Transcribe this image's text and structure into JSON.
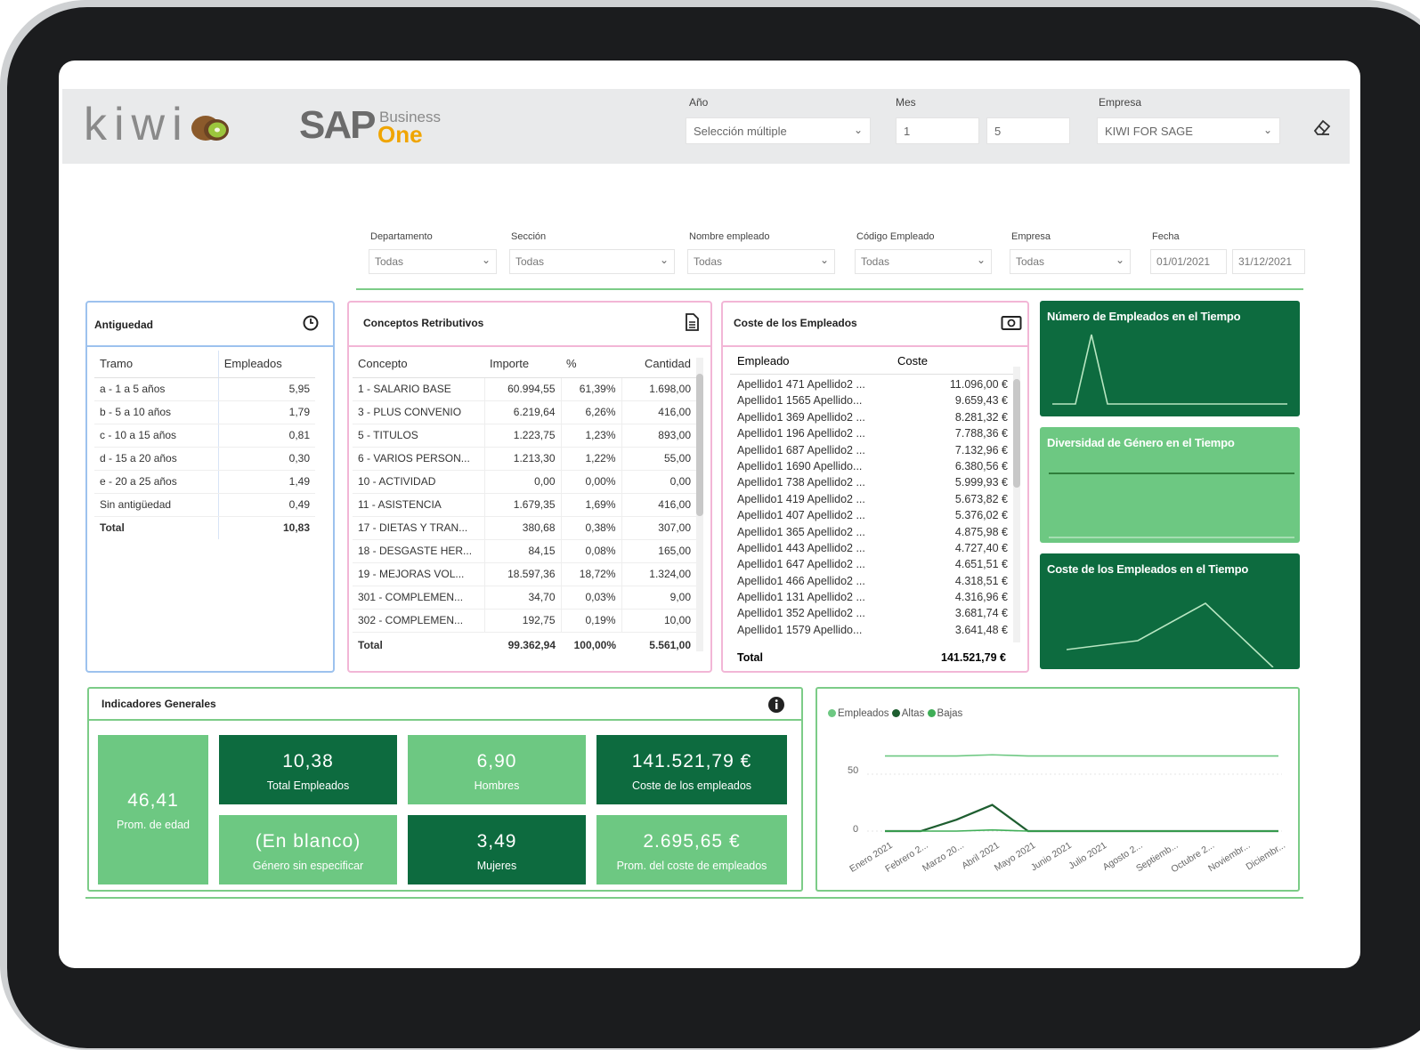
{
  "header": {
    "logo_kiwi": "kiwi",
    "logo_sap": "SAP",
    "logo_business": "Business",
    "logo_one": "One",
    "filters": {
      "anio_label": "Año",
      "anio_value": "Selección múltiple",
      "mes_label": "Mes",
      "mes_from": "1",
      "mes_to": "5",
      "empresa_label": "Empresa",
      "empresa_value": "KIWI FOR SAGE"
    }
  },
  "slicers": {
    "departamento": {
      "label": "Departamento",
      "value": "Todas"
    },
    "seccion": {
      "label": "Sección",
      "value": "Todas"
    },
    "nombre": {
      "label": "Nombre empleado",
      "value": "Todas"
    },
    "codigo": {
      "label": "Código Empleado",
      "value": "Todas"
    },
    "empresa": {
      "label": "Empresa",
      "value": "Todas"
    },
    "fecha": {
      "label": "Fecha",
      "from": "01/01/2021",
      "to": "31/12/2021"
    }
  },
  "antiguedad": {
    "title": "Antiguedad",
    "headers": [
      "Tramo",
      "Empleados"
    ],
    "rows": [
      [
        "a - 1 a 5 años",
        "5,95"
      ],
      [
        "b - 5 a 10 años",
        "1,79"
      ],
      [
        "c - 10 a 15 años",
        "0,81"
      ],
      [
        "d - 15 a 20 años",
        "0,30"
      ],
      [
        "e - 20 a 25 años",
        "1,49"
      ],
      [
        "Sin antigüedad",
        "0,49"
      ]
    ],
    "total": [
      "Total",
      "10,83"
    ]
  },
  "conceptos": {
    "title": "Conceptos Retributivos",
    "headers": [
      "Concepto",
      "Importe",
      "%",
      "Cantidad"
    ],
    "rows": [
      [
        "1 - SALARIO BASE",
        "60.994,55",
        "61,39%",
        "1.698,00"
      ],
      [
        "3 - PLUS CONVENIO",
        "6.219,64",
        "6,26%",
        "416,00"
      ],
      [
        "5 - TITULOS",
        "1.223,75",
        "1,23%",
        "893,00"
      ],
      [
        "6 - VARIOS PERSON...",
        "1.213,30",
        "1,22%",
        "55,00"
      ],
      [
        "10 - ACTIVIDAD",
        "0,00",
        "0,00%",
        "0,00"
      ],
      [
        "11 - ASISTENCIA",
        "1.679,35",
        "1,69%",
        "416,00"
      ],
      [
        "17 - DIETAS Y TRAN...",
        "380,68",
        "0,38%",
        "307,00"
      ],
      [
        "18 - DESGASTE HER...",
        "84,15",
        "0,08%",
        "165,00"
      ],
      [
        "19 - MEJORAS VOL...",
        "18.597,36",
        "18,72%",
        "1.324,00"
      ],
      [
        "301 - COMPLEMEN...",
        "34,70",
        "0,03%",
        "9,00"
      ],
      [
        "302 - COMPLEMEN...",
        "192,75",
        "0,19%",
        "10,00"
      ]
    ],
    "total": [
      "Total",
      "99.362,94",
      "100,00%",
      "5.561,00"
    ]
  },
  "coste": {
    "title": "Coste de los Empleados",
    "headers": [
      "Empleado",
      "Coste"
    ],
    "rows": [
      [
        "Apellido1 471 Apellido2 ...",
        "11.096,00 €"
      ],
      [
        "Apellido1 1565 Apellido...",
        "9.659,43 €"
      ],
      [
        "Apellido1 369 Apellido2 ...",
        "8.281,32 €"
      ],
      [
        "Apellido1 196 Apellido2 ...",
        "7.788,36 €"
      ],
      [
        "Apellido1 687 Apellido2 ...",
        "7.132,96 €"
      ],
      [
        "Apellido1 1690 Apellido...",
        "6.380,56 €"
      ],
      [
        "Apellido1 738 Apellido2 ...",
        "5.999,93 €"
      ],
      [
        "Apellido1 419 Apellido2 ...",
        "5.673,82 €"
      ],
      [
        "Apellido1 407 Apellido2 ...",
        "5.376,02 €"
      ],
      [
        "Apellido1 365 Apellido2 ...",
        "4.875,98 €"
      ],
      [
        "Apellido1 443 Apellido2 ...",
        "4.727,40 €"
      ],
      [
        "Apellido1 647 Apellido2 ...",
        "4.651,51 €"
      ],
      [
        "Apellido1 466 Apellido2 ...",
        "4.318,51 €"
      ],
      [
        "Apellido1 131 Apellido2 ...",
        "4.316,96 €"
      ],
      [
        "Apellido1 352 Apellido2 ...",
        "3.681,74 €"
      ],
      [
        "Apellido1 1579 Apellido...",
        "3.641,48 €"
      ]
    ],
    "total": [
      "Total",
      "141.521,79 €"
    ]
  },
  "tiles": {
    "numero": "Número de Empleados en el Tiempo",
    "diversidad": "Diversidad de Género en el Tiempo",
    "coste": "Coste de los Empleados en el Tiempo"
  },
  "indicadores": {
    "title": "Indicadores Generales",
    "cards": [
      {
        "value": "46,41",
        "label": "Prom. de edad"
      },
      {
        "value": "10,38",
        "label": "Total Empleados"
      },
      {
        "value": "6,90",
        "label": "Hombres"
      },
      {
        "value": "141.521,79 €",
        "label": "Coste de los empleados"
      },
      {
        "value": "(En blanco)",
        "label": "Género sin especificar"
      },
      {
        "value": "3,49",
        "label": "Mujeres"
      },
      {
        "value": "2.695,65 €",
        "label": "Prom. del coste de empleados"
      }
    ]
  },
  "colors": {
    "dark_green": "#0d6b3f",
    "light_green": "#6dc882",
    "accent_line": "#7ccc87"
  },
  "chart_data": {
    "type": "line",
    "legend": [
      "Empleados",
      "Altas",
      "Bajas"
    ],
    "legend_position": "top-left",
    "categories": [
      "Enero 2021",
      "Febrero 2...",
      "Marzo 20...",
      "Abril 2021",
      "Mayo 2021",
      "Junio 2021",
      "Julio 2021",
      "Agosto 2...",
      "Septiemb...",
      "Octubre 2...",
      "Noviembr...",
      "Diciembr..."
    ],
    "y_ticks": [
      "0",
      "50"
    ],
    "ylim": [
      0,
      50
    ],
    "series": [
      {
        "name": "Empleados",
        "color": "#6dc882",
        "values": [
          66,
          66,
          66,
          67,
          66,
          66,
          66,
          66,
          66,
          66,
          66,
          66
        ]
      },
      {
        "name": "Altas",
        "color": "#1e5e30",
        "values": [
          0,
          0,
          10,
          23,
          0,
          0,
          0,
          0,
          0,
          0,
          0,
          0
        ]
      },
      {
        "name": "Bajas",
        "color": "#3fae57",
        "values": [
          0,
          0,
          0,
          1,
          0,
          0,
          0,
          0,
          0,
          0,
          0,
          0
        ]
      }
    ]
  }
}
